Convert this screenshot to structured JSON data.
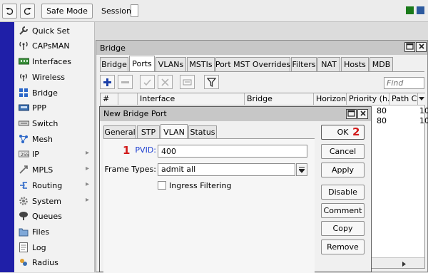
{
  "toolbar": {
    "safe_mode_label": "Safe Mode",
    "session_label": "Session:",
    "indicator_colors": [
      "#1a7a1a",
      "#2d5a9e"
    ]
  },
  "sidebar": {
    "items": [
      {
        "label": "Quick Set",
        "icon": "wrench-icon",
        "submenu": false
      },
      {
        "label": "CAPsMAN",
        "icon": "antenna-icon",
        "submenu": false
      },
      {
        "label": "Interfaces",
        "icon": "interfaces-icon",
        "submenu": false
      },
      {
        "label": "Wireless",
        "icon": "wireless-icon",
        "submenu": false
      },
      {
        "label": "Bridge",
        "icon": "bridge-icon",
        "submenu": false
      },
      {
        "label": "PPP",
        "icon": "ppp-icon",
        "submenu": false
      },
      {
        "label": "Switch",
        "icon": "switch-icon",
        "submenu": false
      },
      {
        "label": "Mesh",
        "icon": "mesh-icon",
        "submenu": false
      },
      {
        "label": "IP",
        "icon": "ip-icon",
        "submenu": true
      },
      {
        "label": "MPLS",
        "icon": "mpls-icon",
        "submenu": true
      },
      {
        "label": "Routing",
        "icon": "routing-icon",
        "submenu": true
      },
      {
        "label": "System",
        "icon": "gear-icon",
        "submenu": true
      },
      {
        "label": "Queues",
        "icon": "queues-icon",
        "submenu": false
      },
      {
        "label": "Files",
        "icon": "folder-icon",
        "submenu": false
      },
      {
        "label": "Log",
        "icon": "log-icon",
        "submenu": false
      },
      {
        "label": "Radius",
        "icon": "radius-icon",
        "submenu": false
      }
    ]
  },
  "bridge_window": {
    "title": "Bridge",
    "tabs": [
      "Bridge",
      "Ports",
      "VLANs",
      "MSTIs",
      "Port MST Overrides",
      "Filters",
      "NAT",
      "Hosts",
      "MDB"
    ],
    "active_tab": "Ports",
    "find_placeholder": "Find",
    "columns": [
      "#",
      "",
      "Interface",
      "Bridge",
      "Horizon",
      "Priority (h...",
      "Path Co"
    ],
    "rows": [
      {
        "priority": "80",
        "path_cost": "10"
      },
      {
        "priority": "80",
        "path_cost": "10"
      }
    ]
  },
  "dialog": {
    "title": "New Bridge Port",
    "tabs": [
      "General",
      "STP",
      "VLAN",
      "Status"
    ],
    "active_tab": "VLAN",
    "pvid_label": "PVID:",
    "pvid_value": "400",
    "frame_types_label": "Frame Types:",
    "frame_types_value": "admit all",
    "ingress_filtering_label": "Ingress Filtering",
    "ingress_filtering_checked": false,
    "buttons": {
      "ok": "OK",
      "cancel": "Cancel",
      "apply": "Apply",
      "disable": "Disable",
      "comment": "Comment",
      "copy": "Copy",
      "remove": "Remove"
    },
    "annotations": {
      "pvid_marker": "1",
      "ok_marker": "2"
    }
  }
}
